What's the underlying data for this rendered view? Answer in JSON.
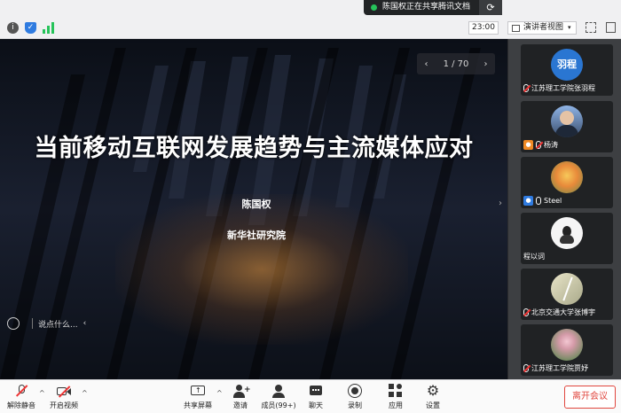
{
  "share_bar": {
    "text": "陈国权正在共享腾讯文档",
    "dot_color": "#26c35a"
  },
  "topbar": {
    "timer": "23:00",
    "view_label": "演讲者视图"
  },
  "slide": {
    "page_indicator": "1 / 70",
    "title": "当前移动互联网发展趋势与主流媒体应对",
    "presenter": "陈国权",
    "organization": "新华社研究院",
    "chat_placeholder": "说点什么..."
  },
  "participants": [
    {
      "name": "江苏理工学院张羽程",
      "avatar_text": "羽程",
      "avatar_color": "#2a76d2",
      "muted": true,
      "badge": ""
    },
    {
      "name": "杨涛",
      "avatar_text": "",
      "avatar_color": "#6b90c8",
      "muted": true,
      "badge": "orange"
    },
    {
      "name": "Steel",
      "avatar_text": "",
      "avatar_color": "#f0b04a",
      "muted": false,
      "badge": "blue"
    },
    {
      "name": "程以词",
      "avatar_text": "",
      "avatar_color": "#f2f2f2",
      "muted": false,
      "badge": ""
    },
    {
      "name": "北京交通大学张博宇",
      "avatar_text": "",
      "avatar_color": "#cfcba7",
      "muted": true,
      "badge": ""
    },
    {
      "name": "江苏理工学院贾妤",
      "avatar_text": "",
      "avatar_color": "#c5d8c0",
      "muted": true,
      "badge": ""
    }
  ],
  "toolbar": {
    "unmute": "解除静音",
    "start_video": "开启视频",
    "share_screen": "共享屏幕",
    "invite": "邀请",
    "members": "成员(99+)",
    "chat": "聊天",
    "record": "录制",
    "apps": "应用",
    "settings": "设置",
    "leave": "离开会议"
  },
  "colors": {
    "accent": "#e0463e",
    "badge_orange": "#f08a24",
    "badge_blue": "#2f7be0"
  }
}
